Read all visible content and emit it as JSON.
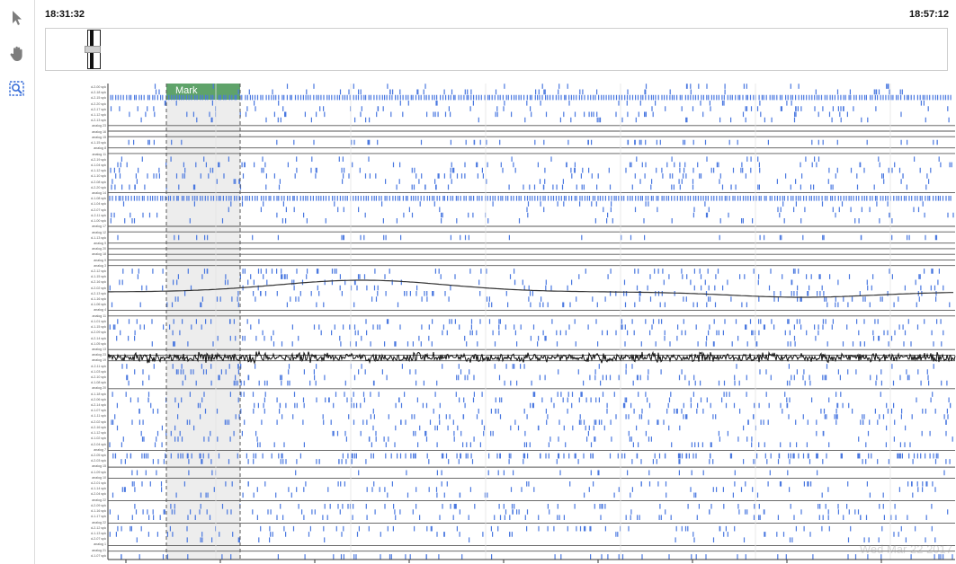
{
  "toolbar": {
    "tools": [
      {
        "name": "pointer-tool",
        "icon": "arrow-pointer-icon",
        "active": false
      },
      {
        "name": "pan-tool",
        "icon": "hand-icon",
        "active": false
      },
      {
        "name": "zoom-tool",
        "icon": "zoom-region-icon",
        "active": true
      }
    ],
    "accent": "#3a6fd8"
  },
  "timeline": {
    "start_time": "18:31:32",
    "end_time": "18:57:12",
    "view_window_fraction": [
      0.046,
      0.055
    ]
  },
  "mark": {
    "label": "Mark",
    "color": "#5fa36a"
  },
  "channels": {
    "labels": [
      "d-2-00 spk",
      "d-2-18 spk",
      "d-2-15 spk",
      "d-2-20 spk",
      "d-2-17 spk",
      "d-1-12 spk",
      "d-2-13 spk",
      "analog 23",
      "analog 16",
      "analog 15",
      "d-1-15 spk",
      "analog 8",
      "analog 11",
      "d-2-19 spk",
      "d-1-04 spk",
      "d-1-12 spk",
      "d-1-10 spk",
      "d-2-08 spk",
      "d-2-20 spk",
      "analog 14",
      "d-1-08 spk",
      "d-1-04 spk",
      "d-2-07 spk",
      "d-2-11 spk",
      "d-1-00 spk",
      "analog 17",
      "analog 12",
      "d-1-13 spk",
      "analog 9",
      "analog 20",
      "analog 18",
      "analog 9",
      "analog 3",
      "d-2-12 spk",
      "d-1-15 spk",
      "d-2-16 spk",
      "d-2-02 spk",
      "d-2-13 spk",
      "d-1-16 spk",
      "d-1-06 spk",
      "analog 4",
      "analog 11",
      "d-1-01 spk",
      "d-1-15 spk",
      "d-2-09 spk",
      "d-2-14 spk",
      "d-1-05 spk",
      "analog 13",
      "analog 23",
      "analog 19",
      "d-2-11 spk",
      "d-1-03 spk",
      "d-2-10 spk",
      "d-1-08 spk",
      "analog 20",
      "d-1-18 spk",
      "d-2-06 spk",
      "d-2-14 spk",
      "d-1-07 spk",
      "d-1-11 spk",
      "d-2-02 spk",
      "d-2-16 spk",
      "d-1-12 spk",
      "d-1-02 spk",
      "d-2-04 spk",
      "analog 7",
      "d-2-05 spk",
      "d-2-03 spk",
      "analog 15",
      "d-1-09 spk",
      "analog 10",
      "d-2-01 spk",
      "d-1-14 spk",
      "d-2-04 spk",
      "analog 22",
      "d-2-09 spk",
      "d-1-16 spk",
      "d-1-17 spk",
      "analog 22",
      "d-2-12 spk",
      "d-1-13 spk",
      "d-2-07 spk",
      "analog 1",
      "analog 21",
      "d-1-07 spk"
    ]
  },
  "watermark": "Wed Mar 22 2017"
}
